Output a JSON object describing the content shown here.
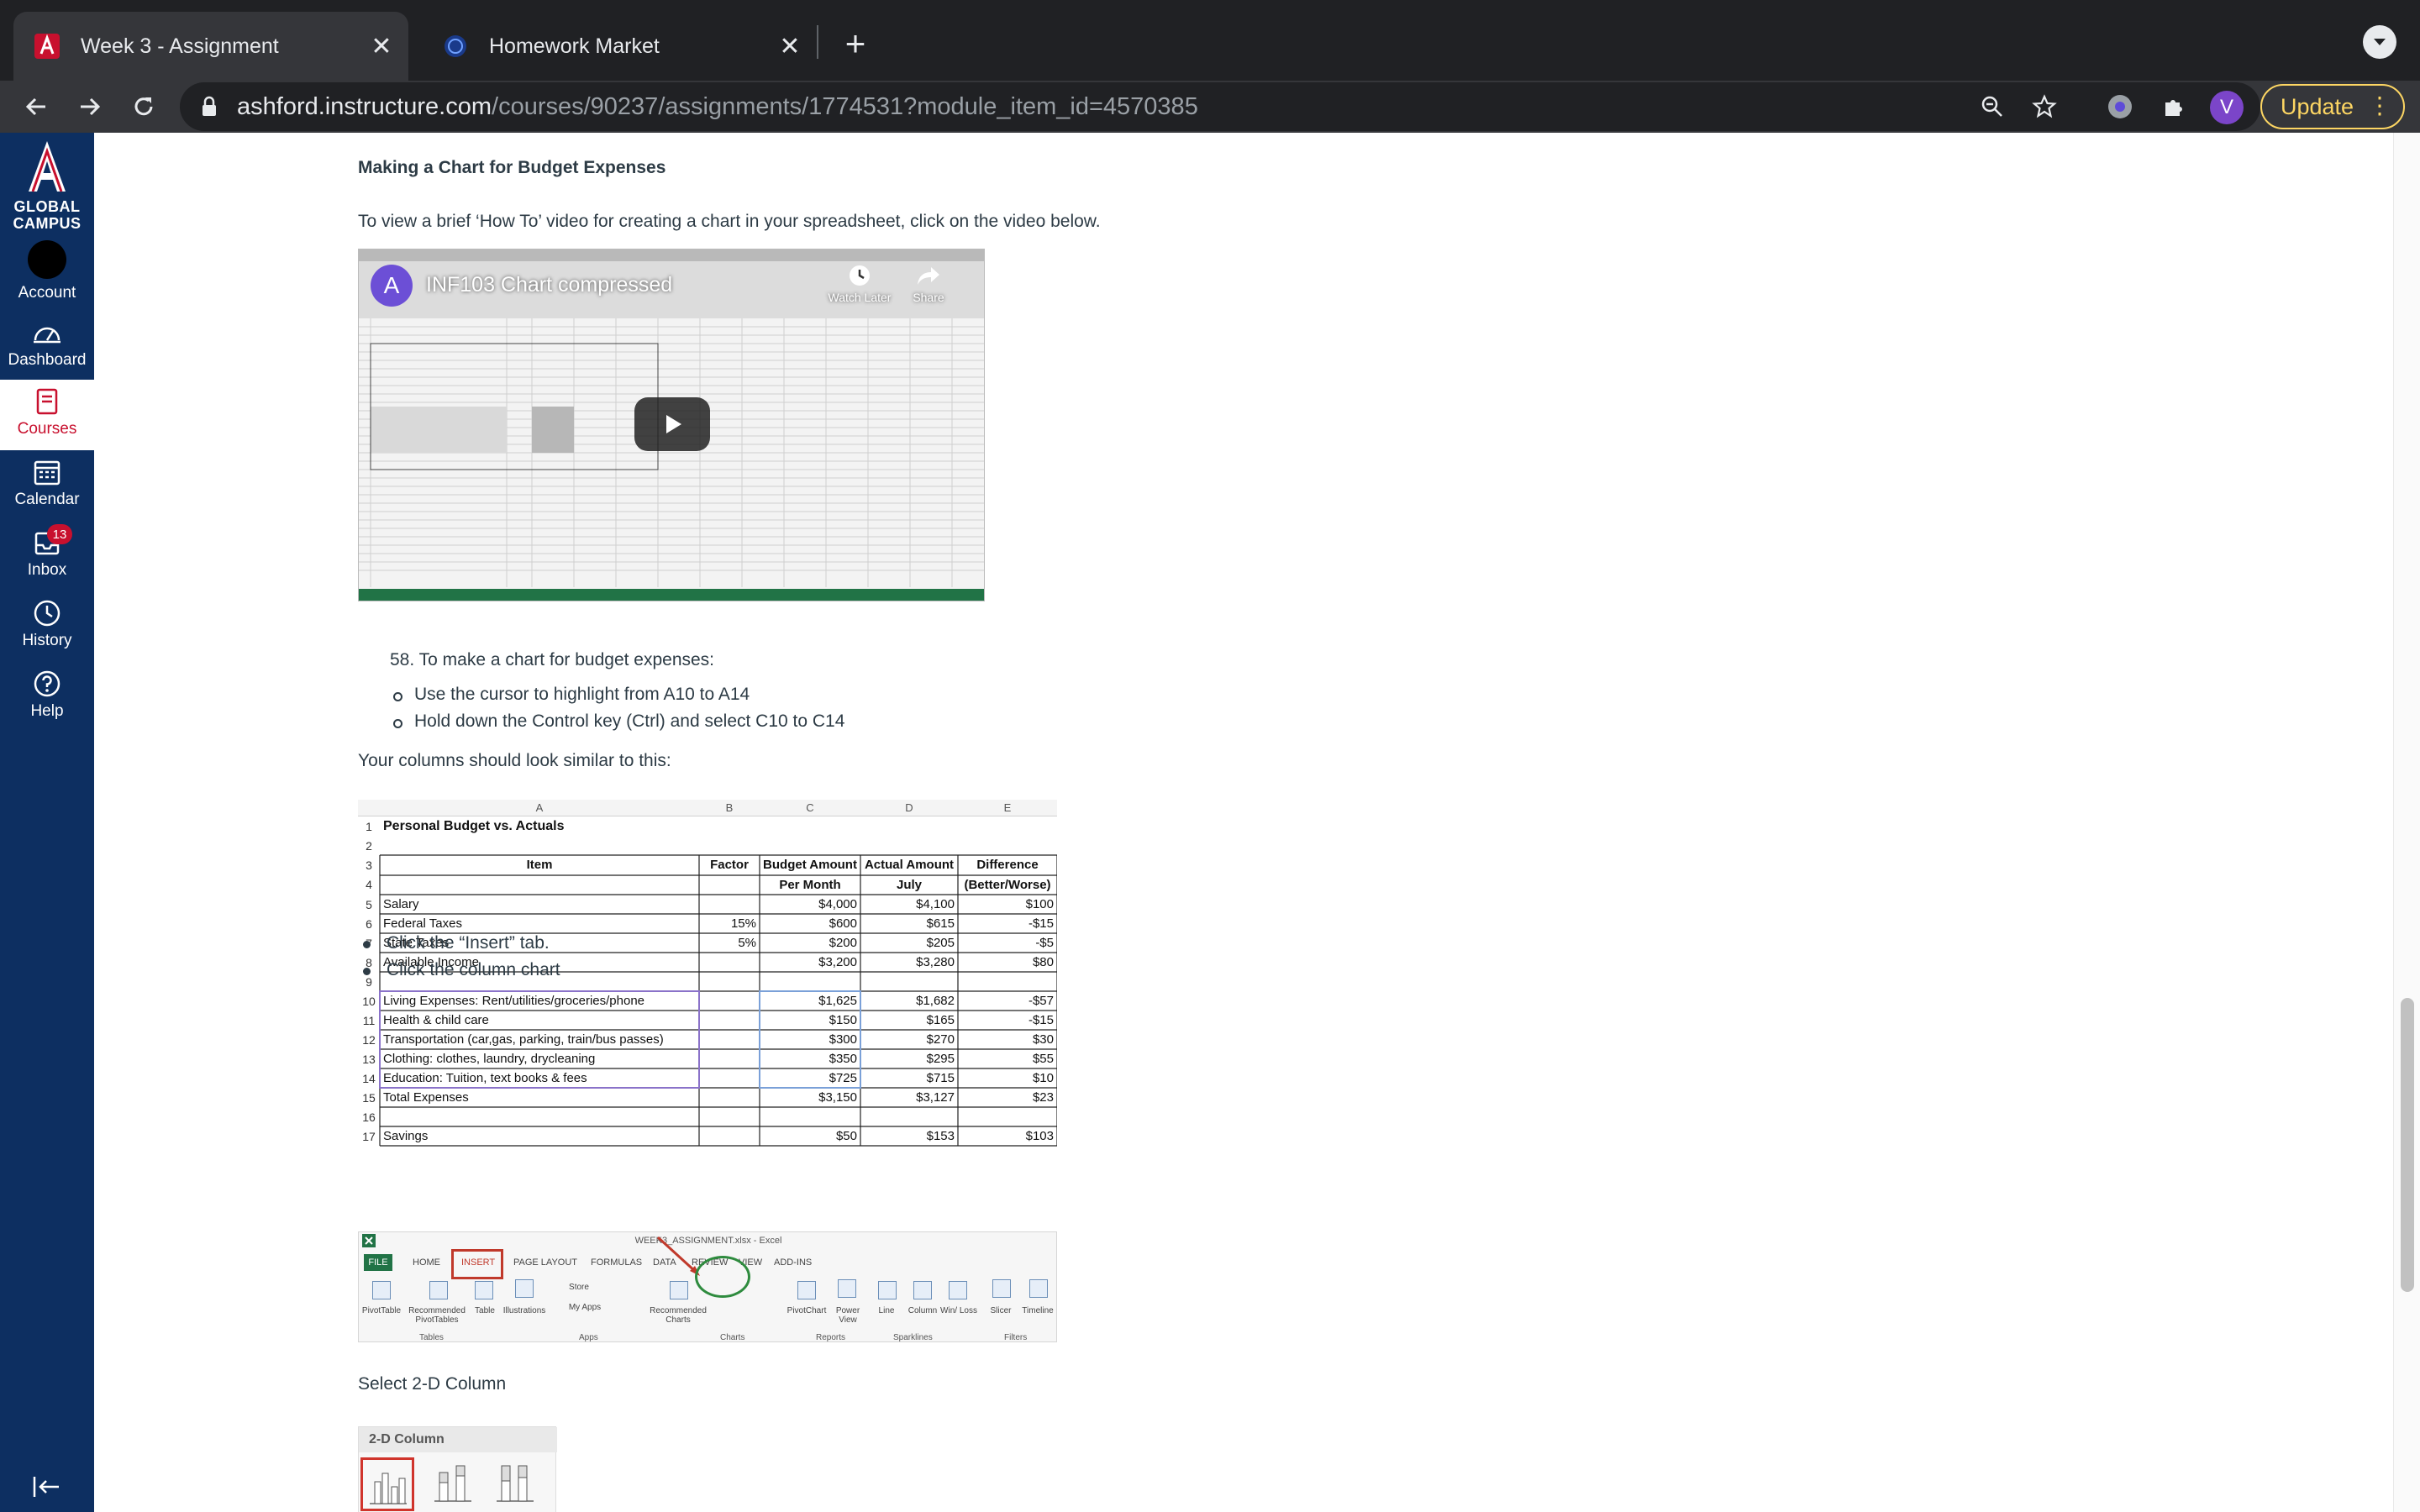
{
  "browser": {
    "tabs": [
      {
        "title": "Week 3 - Assignment",
        "active": true,
        "icon": "arizona-a-icon"
      },
      {
        "title": "Homework Market",
        "active": false,
        "icon": "globe-icon"
      }
    ],
    "url_domain": "ashford.instructure.com",
    "url_path": "/courses/90237/assignments/1774531?module_item_id=4570385",
    "profile_initial": "V",
    "update_label": "Update",
    "colors": {
      "tabbar": "#202124",
      "toolbar": "#35363a",
      "update": "#fdd663"
    }
  },
  "global_nav": {
    "logo_text": "GLOBAL CAMPUS",
    "items": [
      {
        "label": "Account",
        "icon": "account-avatar-icon"
      },
      {
        "label": "Dashboard",
        "icon": "dashboard-icon"
      },
      {
        "label": "Courses",
        "icon": "courses-icon",
        "active": true
      },
      {
        "label": "Calendar",
        "icon": "calendar-icon"
      },
      {
        "label": "Inbox",
        "icon": "inbox-icon",
        "badge": "13"
      },
      {
        "label": "History",
        "icon": "history-icon"
      },
      {
        "label": "Help",
        "icon": "help-icon"
      }
    ],
    "colors": {
      "background": "#0d2f61",
      "active_text": "#c8102e"
    }
  },
  "page": {
    "section_heading": "Making a Chart for Budget Expenses",
    "intro": "To view a brief ‘How To’ video for creating a chart in your spreadsheet, click on the video below.",
    "video": {
      "channel_initial": "A",
      "title": "INF103 Chart compressed",
      "watch_later": "Watch Later",
      "share": "Share"
    },
    "step": "58. To make a chart for budget expenses:",
    "sub_steps": [
      "Use the cursor to highlight from A10 to A14",
      "Hold down the Control key (Ctrl) and select C10 to C14"
    ],
    "columns_note": "Your columns should look similar to this:",
    "click_steps": [
      "Click the “Insert” tab.",
      "Click the column chart"
    ],
    "select_note": "Select 2-D Column",
    "two_d_column_label": "2-D Column"
  },
  "spreadsheet": {
    "col_letters": [
      "A",
      "B",
      "C",
      "D",
      "E"
    ],
    "title": "Personal Budget vs. Actuals",
    "header": {
      "item": "Item",
      "factor": "Factor",
      "budget_1": "Budget Amount",
      "budget_2": "Per Month",
      "actual_1": "Actual Amount",
      "actual_2": "July",
      "diff_1": "Difference",
      "diff_2": "(Better/Worse)"
    },
    "rows": [
      {
        "n": "5",
        "item": "Salary",
        "factor": "",
        "budget": "$4,000",
        "actual": "$4,100",
        "diff": "$100"
      },
      {
        "n": "6",
        "item": "Federal Taxes",
        "factor": "15%",
        "budget": "$600",
        "actual": "$615",
        "diff": "-$15"
      },
      {
        "n": "7",
        "item": "State Taxes",
        "factor": "5%",
        "budget": "$200",
        "actual": "$205",
        "diff": "-$5"
      },
      {
        "n": "8",
        "item": "Available Income",
        "factor": "",
        "budget": "$3,200",
        "actual": "$3,280",
        "diff": "$80"
      },
      {
        "n": "9",
        "item": "",
        "factor": "",
        "budget": "",
        "actual": "",
        "diff": ""
      },
      {
        "n": "10",
        "item": "Living Expenses: Rent/utilities/groceries/phone",
        "factor": "",
        "budget": "$1,625",
        "actual": "$1,682",
        "diff": "-$57"
      },
      {
        "n": "11",
        "item": "Health & child care",
        "factor": "",
        "budget": "$150",
        "actual": "$165",
        "diff": "-$15"
      },
      {
        "n": "12",
        "item": "Transportation (car,gas, parking, train/bus passes)",
        "factor": "",
        "budget": "$300",
        "actual": "$270",
        "diff": "$30"
      },
      {
        "n": "13",
        "item": "Clothing: clothes, laundry, drycleaning",
        "factor": "",
        "budget": "$350",
        "actual": "$295",
        "diff": "$55"
      },
      {
        "n": "14",
        "item": "Education: Tuition, text books & fees",
        "factor": "",
        "budget": "$725",
        "actual": "$715",
        "diff": "$10"
      },
      {
        "n": "15",
        "item": "Total Expenses",
        "factor": "",
        "budget": "$3,150",
        "actual": "$3,127",
        "diff": "$23"
      },
      {
        "n": "16",
        "item": "",
        "factor": "",
        "budget": "",
        "actual": "",
        "diff": ""
      },
      {
        "n": "17",
        "item": "Savings",
        "factor": "",
        "budget": "$50",
        "actual": "$153",
        "diff": "$103"
      }
    ]
  },
  "excel_ribbon": {
    "window_title": "WEEK3_ASSIGNMENT.xlsx - Excel",
    "tabs": [
      "FILE",
      "HOME",
      "INSERT",
      "PAGE LAYOUT",
      "FORMULAS",
      "DATA",
      "REVIEW",
      "VIEW",
      "ADD-INS"
    ],
    "buttons": [
      "PivotTable",
      "Recommended PivotTables",
      "Table",
      "Illustrations",
      "Store",
      "My Apps",
      "Recommended Charts",
      "PivotChart",
      "Power View",
      "Line",
      "Column",
      "Win/ Loss",
      "Slicer",
      "Timeline"
    ],
    "groups": [
      "Tables",
      "Apps",
      "Charts",
      "Reports",
      "Sparklines",
      "Filters"
    ]
  }
}
